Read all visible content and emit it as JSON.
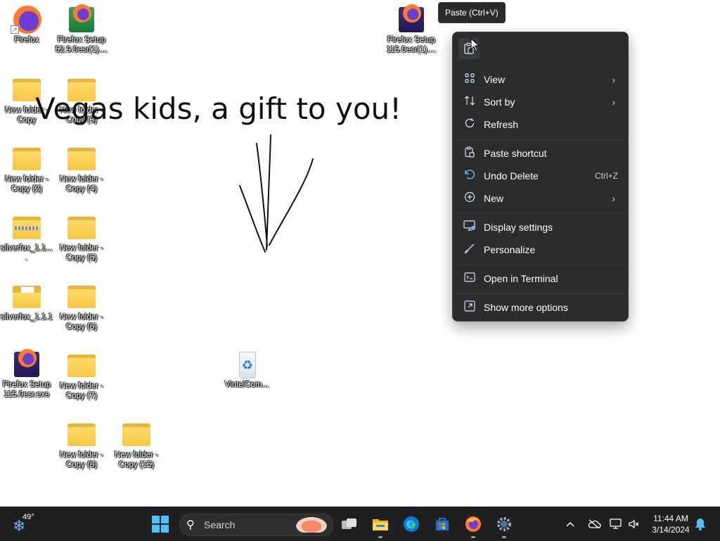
{
  "desktop": {
    "icons": [
      {
        "label": "Firefox",
        "kind": "firefox"
      },
      {
        "label": "Firefox Setup 52.9.0esr(1)....",
        "kind": "setup-green"
      },
      {
        "label": "Firefox Setup 115.0esr(1)....",
        "kind": "setup"
      },
      {
        "label": "New folder - Copy",
        "kind": "folder"
      },
      {
        "label": "New folder - Copy (3)",
        "kind": "folder"
      },
      {
        "label": "New folder - Copy (2)",
        "kind": "folder"
      },
      {
        "label": "New folder - Copy (4)",
        "kind": "folder"
      },
      {
        "label": "silverfox_1.1....",
        "kind": "zip-folder"
      },
      {
        "label": "New folder - Copy (5)",
        "kind": "folder"
      },
      {
        "label": "silverfox_1.1.1",
        "kind": "folder-doc"
      },
      {
        "label": "New folder - Copy (6)",
        "kind": "folder"
      },
      {
        "label": "Firefox Setup 115.0esr.exe",
        "kind": "setup"
      },
      {
        "label": "New folder - Copy (7)",
        "kind": "folder"
      },
      {
        "label": "New folder - Copy (8)",
        "kind": "folder"
      },
      {
        "label": "New folder - Copy (15)",
        "kind": "folder"
      },
      {
        "label": "VintelCom...",
        "kind": "recycle-bin"
      }
    ],
    "banner_text": "Vegas kids, a gift to you!"
  },
  "tooltip": {
    "text": "Paste (Ctrl+V)"
  },
  "context_menu": {
    "quick_action_icon": "paste-icon",
    "items": [
      {
        "label": "View",
        "icon": "grid-icon",
        "submenu": true
      },
      {
        "label": "Sort by",
        "icon": "sort-icon",
        "submenu": true
      },
      {
        "label": "Refresh",
        "icon": "refresh-icon"
      },
      {
        "label": "Paste shortcut",
        "icon": "paste-shortcut-icon"
      },
      {
        "label": "Undo Delete",
        "icon": "undo-icon",
        "accelerator": "Ctrl+Z"
      },
      {
        "label": "New",
        "icon": "new-icon",
        "submenu": true
      },
      {
        "label": "Display settings",
        "icon": "display-icon"
      },
      {
        "label": "Personalize",
        "icon": "brush-icon"
      },
      {
        "label": "Open in Terminal",
        "icon": "terminal-icon"
      },
      {
        "label": "Show more options",
        "icon": "more-options-icon"
      }
    ]
  },
  "taskbar": {
    "weather": {
      "temp": "49°",
      "icon": "snowflake-icon"
    },
    "search": {
      "placeholder": "Search"
    },
    "apps": [
      "start-icon",
      "task-view-icon",
      "file-explorer-icon",
      "edge-icon",
      "store-icon",
      "firefox-icon",
      "settings-icon"
    ],
    "clock": {
      "time": "11:44 AM",
      "date": "3/14/2024"
    }
  },
  "colors": {
    "menu_bg": "#2c2c2c",
    "taskbar_bg": "#202020",
    "accent": "#4cc2ff",
    "desktop_bg": "#ffffff"
  }
}
